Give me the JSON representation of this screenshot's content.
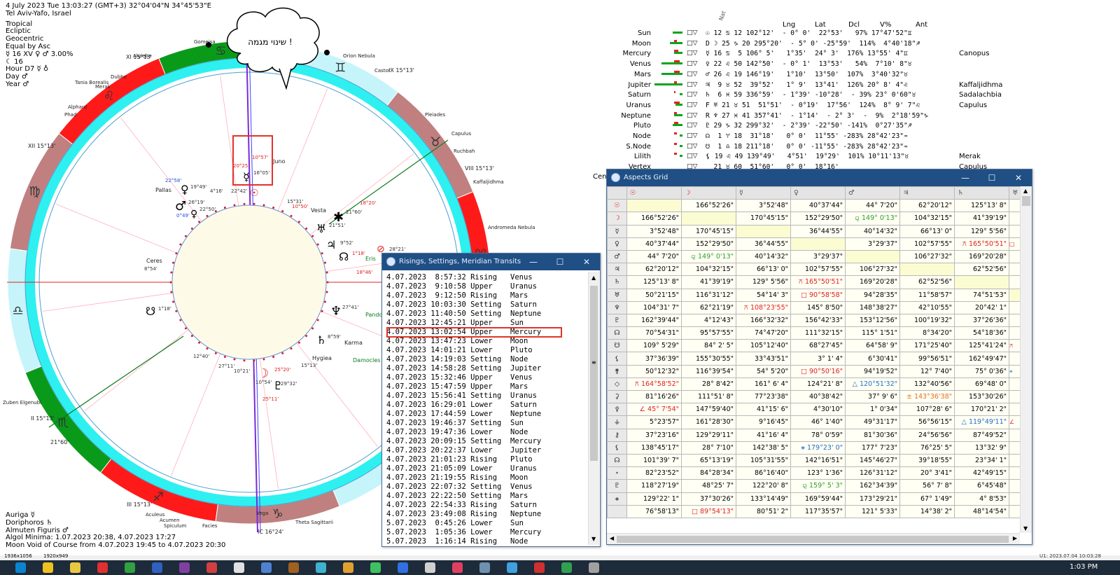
{
  "header": {
    "line1": "4 July 2023   Tue   13:03:27 (GMT+3) 32°04'04\"N  34°45'53\"E",
    "line2": "Tel Aviv-Yafo, Israel",
    "settings": [
      "Tropical",
      "Ecliptic",
      "Geocentric",
      "Equal by Asc"
    ],
    "asc_ruler": "☿ 16 XV ♀ ♂ 3.00%",
    "moon_house": "☾ 16",
    "hour": "Hour D7 ☿ ♁",
    "day": "Day ♂",
    "year": "Year ♂"
  },
  "footer": {
    "auriga": "Auriga ☿",
    "doriphoros": "Doriphoros ♄",
    "almuten": "Almuten Figuris ♂",
    "algol": "Algol Minima: 1.07.2023 20:38,  4.07.2023 17:27",
    "void": "Moon Void of Course from 4.07.2023 19:45 to 4.07.2023 20:30",
    "resolution1": "1936x1056",
    "resolution2": "1920x949",
    "timestamp": "U1: 2023.07.04 10:03:28",
    "clock": "1:03 PM"
  },
  "speech_bubble": "שינוי מגמה !",
  "chart_labels": {
    "stars": [
      "Orion Nebula",
      "Pleiades",
      "Capulus",
      "Ruchbah",
      "Kaffaljidhma",
      "Andromeda Nebula",
      "Tania Borealis",
      "Merak",
      "Alphard",
      "Phad",
      "Dubhe",
      "Algieba",
      "Zuben Elgenubi",
      "Aculeus",
      "Acumen",
      "Spiculum",
      "Facies",
      "Vega",
      "Theta Sagittarii",
      "Gomeisa",
      "Castor"
    ],
    "bodies": [
      "Pallas",
      "Ceres",
      "Juno",
      "Vesta",
      "Hygiea",
      "Karma",
      "Damocles",
      "Eris",
      "Pandora"
    ],
    "cusps": [
      "XII 15°13'",
      "XI 15°13'",
      "II 15°13'",
      "III 15°13'",
      "VIII 15°13'",
      "IX 15°13'",
      "IC 16°24'",
      "21°60'"
    ],
    "degrees": [
      "10°57'",
      "20°25'",
      "16°05'",
      "19°49'",
      "26°19'",
      "22°50'",
      "0°49'",
      "22°58'",
      "4°16'",
      "22°42'",
      "15°31'",
      "10°50'",
      "21°51'",
      "9°52'",
      "1°18'",
      "18°20'",
      "21°60'",
      "28°21'",
      "18°46'",
      "27°41'",
      "8°59'",
      "15°13'",
      "25°20'",
      "29°32'",
      "25°11'",
      "10°54'",
      "12°40'",
      "27°11'",
      "10°21'",
      "1°18'",
      "8°54'"
    ]
  },
  "planet_table": {
    "nat_label": "Nat",
    "columns": [
      "Lng",
      "Lat",
      "Dcl",
      "V%",
      "Ant"
    ],
    "rows": [
      {
        "name": "Sun",
        "pos": "☉ 12 ♋ 12 102°12'  - 0° 0'  22°53'   97% 17°47'52\"♊",
        "star": ""
      },
      {
        "name": "Moon",
        "pos": "D ☽ 25 ♑ 20 295°20'  - 5° 0' -25°59'  114%  4°40'18\"♐",
        "star": ""
      },
      {
        "name": "Mercury",
        "pos": "☿ 16 ♋  5 106° 5'   1°35'  24° 3'  176% 13°55' 4\"♊",
        "star": "Canopus"
      },
      {
        "name": "Venus",
        "pos": "♀ 22 ♌ 50 142°50'  - 0° 1'  13°53'   54%  7°10' 8\"♉",
        "star": ""
      },
      {
        "name": "Mars",
        "pos": "♂ 26 ♌ 19 146°19'   1°10'  13°50'  107%  3°40'32\"♉",
        "star": ""
      },
      {
        "name": "Jupiter",
        "pos": "♃  9 ♉ 52  39°52'   1° 9'  13°41'  126% 20° 8' 4\"♌",
        "star": "Kaffaljidhma"
      },
      {
        "name": "Saturn",
        "pos": "♄  6 ♓ 59 336°59'  - 1°39' -10°28'  - 39% 23° 0'60\"♉",
        "star": "Sadalachbia"
      },
      {
        "name": "Uranus",
        "pos": "F ♅ 21 ♉ 51  51°51'  - 0°19'  17°56'  124%  8° 9' 7\"♌",
        "star": "Capulus"
      },
      {
        "name": "Neptune",
        "pos": "R ♆ 27 ♓ 41 357°41'  - 1°14'  - 2° 3'  -  9%  2°18'59\"♑",
        "star": ""
      },
      {
        "name": "Pluto",
        "pos": "♇ 29 ♑ 32 299°32'  - 2°39' -22°50' -141%  0°27'35\"♐",
        "star": ""
      },
      {
        "name": "Node",
        "pos": "☊  1 ♈ 18  31°18'   0° 0'  11°55' -283% 28°42'23\"♒",
        "star": ""
      },
      {
        "name": "S.Node",
        "pos": "☋  1 ♎ 18 211°18'   0° 0' -11°55' -283% 28°42'23\"♒",
        "star": ""
      },
      {
        "name": "Lilith",
        "pos": "⚸ 19 ♌ 49 139°49'   4°51'  19°29'  101% 10°11'13\"♉",
        "star": "Merak"
      },
      {
        "name": "Vertex",
        "pos": "  21 ♉ 60  51°60'   0° 0'  18°16'",
        "star": "Capulus"
      }
    ],
    "cen_label": "Cen"
  },
  "rs_window": {
    "title": "Risings, Settings, Meridian Transits",
    "highlight_index": 6,
    "entries": [
      "4.07.2023  8:57:32 Rising   Venus",
      "4.07.2023  9:10:58 Upper    Uranus",
      "4.07.2023  9:12:50 Rising   Mars",
      "4.07.2023 10:03:30 Setting  Saturn",
      "4.07.2023 11:40:50 Setting  Neptune",
      "4.07.2023 12:45:21 Upper    Sun",
      "4.07.2023 13:02:54 Upper    Mercury",
      "4.07.2023 13:47:23 Lower    Moon",
      "4.07.2023 14:01:21 Lower    Pluto",
      "4.07.2023 14:19:03 Setting  Node",
      "4.07.2023 14:58:28 Setting  Jupiter",
      "4.07.2023 15:32:46 Upper    Venus",
      "4.07.2023 15:47:59 Upper    Mars",
      "4.07.2023 15:56:41 Setting  Uranus",
      "4.07.2023 16:29:01 Lower    Saturn",
      "4.07.2023 17:44:59 Lower    Neptune",
      "4.07.2023 19:46:37 Setting  Sun",
      "4.07.2023 19:47:36 Lower    Node",
      "4.07.2023 20:09:15 Setting  Mercury",
      "4.07.2023 20:22:37 Lower    Jupiter",
      "4.07.2023 21:01:23 Rising   Pluto",
      "4.07.2023 21:05:09 Lower    Uranus",
      "4.07.2023 21:19:55 Rising   Moon",
      "4.07.2023 22:07:32 Setting  Venus",
      "4.07.2023 22:22:50 Setting  Mars",
      "4.07.2023 22:54:33 Rising   Saturn",
      "4.07.2023 23:49:08 Rising   Neptune",
      "5.07.2023  0:45:26 Lower    Sun",
      "5.07.2023  1:05:36 Lower    Mercury",
      "5.07.2023  1:16:14 Rising   Node"
    ]
  },
  "aspects_window": {
    "title": "Aspects Grid",
    "col_headers": [
      "☉",
      "☽",
      "☿",
      "♀",
      "♂",
      "♃",
      "♄",
      "♅"
    ],
    "row_headers": [
      "☉",
      "☽",
      "☿",
      "♀",
      "♂",
      "♃",
      "♄",
      "♅",
      "♆",
      "♇",
      "☊",
      "☋",
      "⚸",
      "⚵",
      "◇",
      "⚳",
      "⚴",
      "⚶",
      "⚷",
      "⚸",
      "☊",
      "⋆",
      "♇",
      "⚹"
    ],
    "rows": [
      [
        "",
        "166°52'26\"",
        "3°52'48\"",
        "40°37'44\"",
        "44° 7'20\"",
        "62°20'12\"",
        "125°13' 8\"",
        ""
      ],
      [
        "166°52'26\"",
        "",
        "170°45'15\"",
        "152°29'50\"",
        "⚼ 149° 0'13\"",
        "104°32'15\"",
        "41°39'19\"",
        ""
      ],
      [
        "3°52'48\"",
        "170°45'15\"",
        "",
        "36°44'55\"",
        "40°14'32\"",
        "66°13' 0\"",
        "129° 5'56\"",
        ""
      ],
      [
        "40°37'44\"",
        "152°29'50\"",
        "36°44'55\"",
        "",
        "3°29'37\"",
        "102°57'55\"",
        "⚻ 165°50'51\"",
        "□"
      ],
      [
        "44° 7'20\"",
        "⚼ 149° 0'13\"",
        "40°14'32\"",
        "3°29'37\"",
        "",
        "106°27'32\"",
        "169°20'28\"",
        ""
      ],
      [
        "62°20'12\"",
        "104°32'15\"",
        "66°13' 0\"",
        "102°57'55\"",
        "106°27'32\"",
        "",
        "62°52'56\"",
        ""
      ],
      [
        "125°13' 8\"",
        "41°39'19\"",
        "129° 5'56\"",
        "⚻ 165°50'51\"",
        "169°20'28\"",
        "62°52'56\"",
        "",
        ""
      ],
      [
        "50°21'15\"",
        "116°31'12\"",
        "54°14' 3\"",
        "□ 90°58'58\"",
        "94°28'35\"",
        "11°58'57\"",
        "74°51'53\"",
        ""
      ],
      [
        "104°31' 7\"",
        "62°21'19\"",
        "⚻ 108°23'55\"",
        "145° 8'50\"",
        "148°38'27\"",
        "42°10'55\"",
        "20°42' 1\"",
        ""
      ],
      [
        "162°39'44\"",
        "4°12'43\"",
        "166°32'32\"",
        "156°42'33\"",
        "153°12'56\"",
        "100°19'32\"",
        "37°26'36\"",
        ""
      ],
      [
        "70°54'31\"",
        "95°57'55\"",
        "74°47'20\"",
        "111°32'15\"",
        "115° 1'51\"",
        "8°34'20\"",
        "54°18'36\"",
        ""
      ],
      [
        "109° 5'29\"",
        "84° 2' 5\"",
        "105°12'40\"",
        "68°27'45\"",
        "64°58' 9\"",
        "171°25'40\"",
        "125°41'24\"",
        "⚻"
      ],
      [
        "37°36'39\"",
        "155°30'55\"",
        "33°43'51\"",
        "3° 1' 4\"",
        "6°30'41\"",
        "99°56'51\"",
        "162°49'47\"",
        ""
      ],
      [
        "50°12'32\"",
        "116°39'54\"",
        "54° 5'20\"",
        "□ 90°50'16\"",
        "94°19'52\"",
        "12° 7'40\"",
        "75° 0'36\"",
        "⚹"
      ],
      [
        "⚻ 164°58'52\"",
        "28° 8'42\"",
        "161° 6' 4\"",
        "124°21' 8\"",
        "△ 120°51'32\"",
        "132°40'56\"",
        "69°48' 0\"",
        ""
      ],
      [
        "81°16'26\"",
        "111°51' 8\"",
        "77°23'38\"",
        "40°38'42\"",
        "37° 9' 6\"",
        "± 143°36'38\"",
        "153°30'26\"",
        ""
      ],
      [
        "∠ 45° 7'54\"",
        "147°59'40\"",
        "41°15' 6\"",
        "4°30'10\"",
        "1° 0'34\"",
        "107°28' 6\"",
        "170°21' 2\"",
        ""
      ],
      [
        "5°23'57\"",
        "161°28'30\"",
        "9°16'45\"",
        "46° 1'40\"",
        "49°31'17\"",
        "56°56'15\"",
        "△ 119°49'11\"",
        "∠"
      ],
      [
        "37°23'16\"",
        "129°29'11\"",
        "41°16' 4\"",
        "78° 0'59\"",
        "81°30'36\"",
        "24°56'56\"",
        "87°49'52\"",
        ""
      ],
      [
        "138°45'17\"",
        "28° 7'10\"",
        "142°38' 5\"",
        "⚹ 179°23' 0\"",
        "177° 7'23\"",
        "76°25' 5\"",
        "13°32' 9\"",
        ""
      ],
      [
        "101°39' 7\"",
        "65°13'19\"",
        "105°31'55\"",
        "142°16'51\"",
        "145°46'27\"",
        "39°18'55\"",
        "23°34' 1\"",
        ""
      ],
      [
        "82°23'52\"",
        "84°28'34\"",
        "86°16'40\"",
        "123° 1'36\"",
        "126°31'12\"",
        "20° 3'41\"",
        "42°49'15\"",
        ""
      ],
      [
        "118°27'19\"",
        "48°25' 7\"",
        "122°20' 8\"",
        "⚼ 159° 5' 3\"",
        "162°34'39\"",
        "56° 7' 8\"",
        "6°45'48\"",
        ""
      ],
      [
        "129°22' 1\"",
        "37°30'26\"",
        "133°14'49\"",
        "169°59'44\"",
        "173°29'21\"",
        "67° 1'49\"",
        "4° 8'53\"",
        ""
      ],
      [
        "76°58'13\"",
        "□ 89°54'13\"",
        "80°51' 2\"",
        "117°35'57\"",
        "121° 5'33\"",
        "14°38' 2\"",
        "48°14'54\"",
        ""
      ]
    ]
  },
  "colors": {
    "titlebar": "#1f4f84",
    "cyan_ring": "#2ef0f0",
    "pale_cyan": "#c6f4fb",
    "red_sector": "#ff1a1a",
    "brown_sector": "#c08080",
    "green_sector": "#0a9a1a",
    "highlight_box": "#e0332a"
  }
}
